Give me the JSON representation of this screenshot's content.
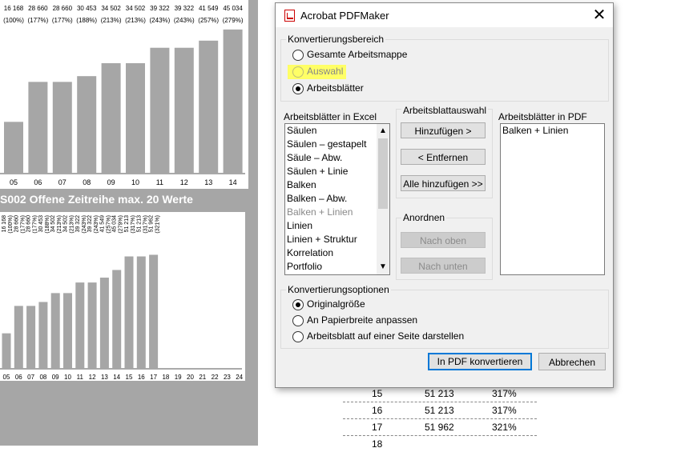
{
  "background": {
    "sheet_title": "S002 Offene Zeitreihe max. 20 Werte",
    "chart_data": [
      {
        "type": "bar",
        "categories": [
          "05",
          "06",
          "07",
          "08",
          "09",
          "10",
          "11",
          "12",
          "13",
          "14"
        ],
        "values": [
          16168,
          28660,
          28660,
          30453,
          34502,
          34502,
          39322,
          39322,
          41549,
          45034
        ],
        "value_labels": [
          "16 168",
          "28 660",
          "28 660",
          "30 453",
          "34 502",
          "34 502",
          "39 322",
          "39 322",
          "41 549",
          "45 034"
        ],
        "percent_labels": [
          "(100%)",
          "(177%)",
          "(177%)",
          "(188%)",
          "(213%)",
          "(213%)",
          "(243%)",
          "(243%)",
          "(257%)",
          "(279%)"
        ],
        "ylim": [
          0,
          50000
        ]
      },
      {
        "type": "bar",
        "categories": [
          "05",
          "06",
          "07",
          "08",
          "09",
          "10",
          "11",
          "12",
          "13",
          "14",
          "15",
          "16",
          "17",
          "18",
          "19",
          "20",
          "21",
          "22",
          "23",
          "24"
        ],
        "values": [
          16168,
          28660,
          28660,
          30453,
          34502,
          34502,
          39322,
          39322,
          41549,
          45034,
          51213,
          51213,
          51962,
          null,
          null,
          null,
          null,
          null,
          null,
          null
        ],
        "value_labels": [
          "16 168",
          "28 660",
          "28 660",
          "30 453",
          "34 502",
          "34 502",
          "39 322",
          "39 322",
          "41 549",
          "45 034",
          "51 213",
          "51 213",
          "51 962"
        ],
        "percent_labels": [
          "(100%)",
          "(177%)",
          "(177%)",
          "(188%)",
          "(213%)",
          "(213%)",
          "(243%)",
          "(243%)",
          "(257%)",
          "(279%)",
          "(317%)",
          "(317%)",
          "(321%)"
        ],
        "ylim": [
          0,
          70000
        ]
      }
    ],
    "table_rows": [
      {
        "n": "15",
        "value": "51 213",
        "pct": "317%"
      },
      {
        "n": "16",
        "value": "51 213",
        "pct": "317%"
      },
      {
        "n": "17",
        "value": "51 962",
        "pct": "321%"
      },
      {
        "n": "18",
        "value": "",
        "pct": ""
      }
    ]
  },
  "dialog": {
    "title": "Acrobat PDFMaker",
    "close_glyph": "✕",
    "conversion_range": {
      "label": "Konvertierungsbereich",
      "options": [
        "Gesamte Arbeitsmappe",
        "Auswahl",
        "Arbeitsblätter"
      ],
      "selected": "Arbeitsblätter"
    },
    "excel_sheets": {
      "label": "Arbeitsblätter in Excel",
      "items": [
        "Säulen",
        "Säulen – gestapelt",
        "Säule – Abw.",
        "Säulen + Linie",
        "Balken",
        "Balken – Abw.",
        "Balken + Linien",
        "Linien",
        "Linien + Struktur",
        "Korrelation",
        "Portfolio"
      ],
      "dimmed_item": "Balken + Linien"
    },
    "sheet_selection": {
      "label": "Arbeitsblattauswahl",
      "add": "Hinzufügen >",
      "remove": "< Entfernen",
      "add_all": "Alle hinzufügen >>"
    },
    "arrange": {
      "label": "Anordnen",
      "up": "Nach oben",
      "down": "Nach unten"
    },
    "pdf_sheets": {
      "label": "Arbeitsblätter in PDF",
      "items": [
        "Balken + Linien"
      ]
    },
    "conversion_options": {
      "label": "Konvertierungsoptionen",
      "options": [
        "Originalgröße",
        "An Papierbreite anpassen",
        "Arbeitsblatt auf einer Seite darstellen"
      ],
      "selected": "Originalgröße"
    },
    "convert_button": "In PDF konvertieren",
    "cancel_button": "Abbrechen",
    "colors": {
      "highlight": "#ffff66",
      "default_button_border": "#0078d7"
    }
  }
}
